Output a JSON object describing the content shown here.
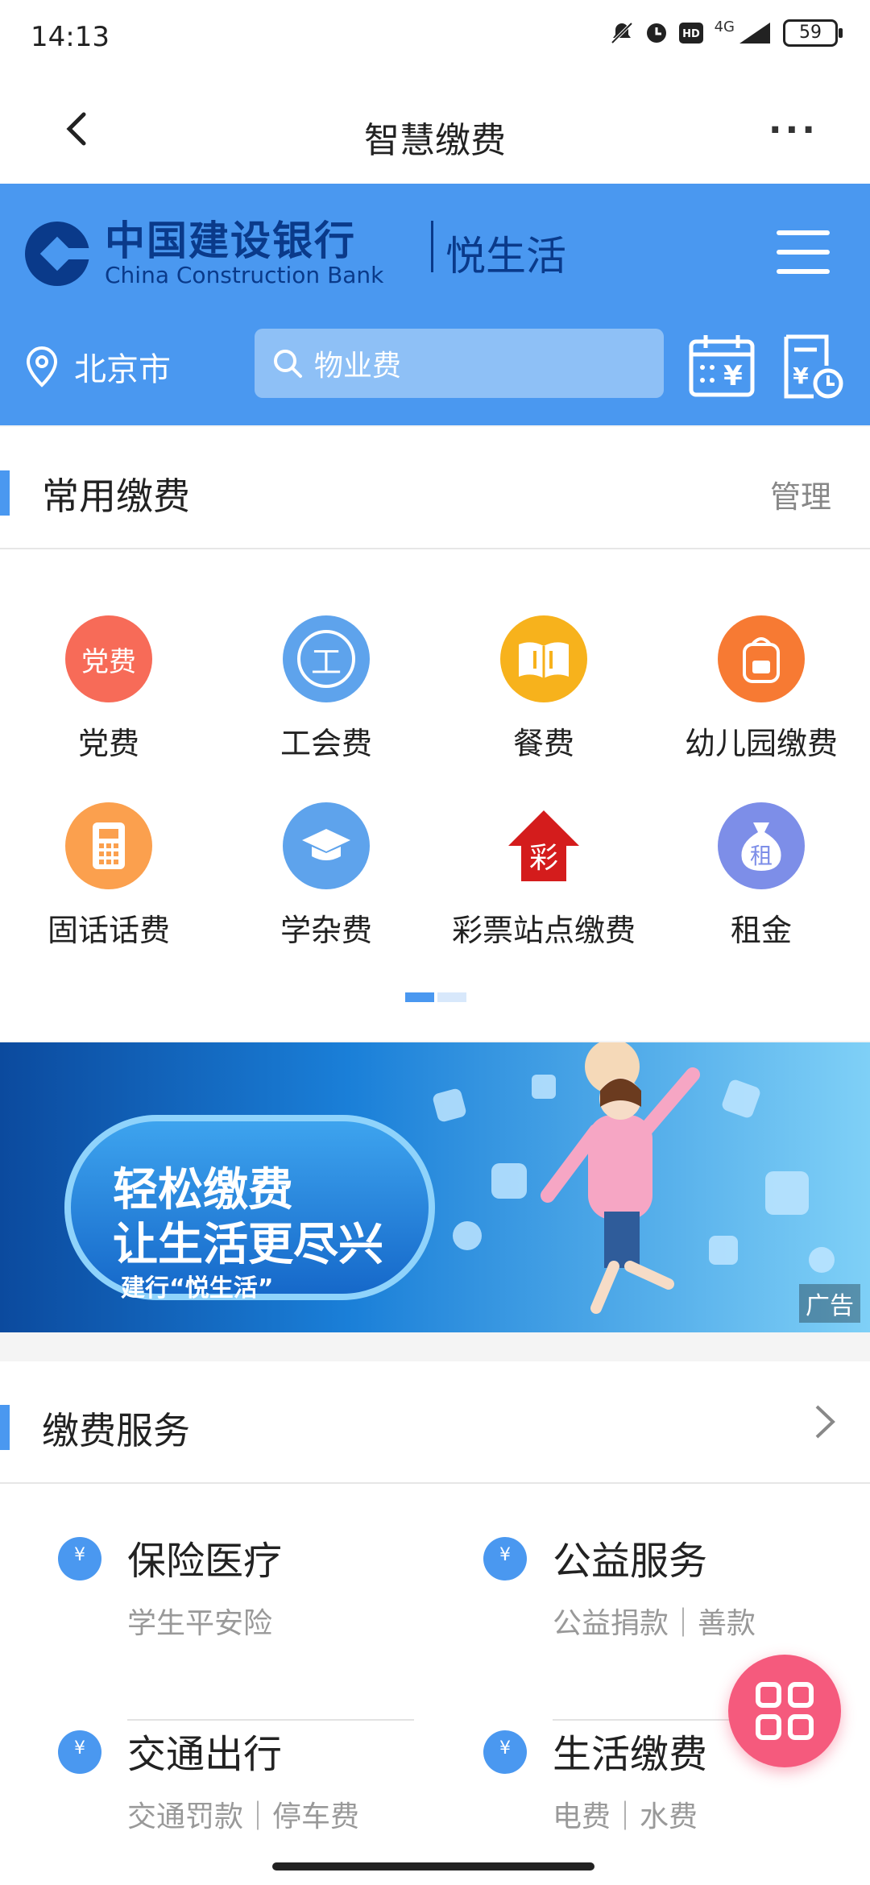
{
  "status": {
    "time": "14:13",
    "network": "4G",
    "battery": "59"
  },
  "nav": {
    "title": "智慧缴费",
    "more": "···"
  },
  "bank": {
    "name_cn": "中国建设银行",
    "name_en": "China Construction Bank",
    "brand": "悦生活",
    "city": "北京市",
    "search_placeholder": "物业费"
  },
  "common": {
    "title": "常用缴费",
    "manage": "管理",
    "items": [
      {
        "label": "党费",
        "icon": "party-fee-icon",
        "icon_text": "党费",
        "color": "#f76b58"
      },
      {
        "label": "工会费",
        "icon": "union-fee-icon",
        "icon_text": "工",
        "color": "#5ea3ec"
      },
      {
        "label": "餐费",
        "icon": "meal-fee-icon",
        "icon_text": "",
        "color": "#f7b21c"
      },
      {
        "label": "幼儿园缴费",
        "icon": "kindergarten-icon",
        "icon_text": "",
        "color": "#f77a33"
      },
      {
        "label": "固话话费",
        "icon": "landline-icon",
        "icon_text": "",
        "color": "#fba04e"
      },
      {
        "label": "学杂费",
        "icon": "tuition-icon",
        "icon_text": "",
        "color": "#5ea3ec"
      },
      {
        "label": "彩票站点缴费",
        "icon": "lottery-icon",
        "icon_text": "彩",
        "color": "#d41c1c"
      },
      {
        "label": "租金",
        "icon": "rent-icon",
        "icon_text": "租",
        "color": "#7d8ee8"
      }
    ]
  },
  "banner": {
    "line1": "轻松缴费",
    "line2": "让生活更尽兴",
    "line3": "建行“悦生活”",
    "ad": "广告"
  },
  "services": {
    "title": "缴费服务",
    "items": [
      {
        "title": "保险医疗",
        "subtitle": "学生平安险"
      },
      {
        "title": "公益服务",
        "subtitle": "公益捐款｜善款"
      },
      {
        "title": "交通出行",
        "subtitle": "交通罚款｜停车费"
      },
      {
        "title": "生活缴费",
        "subtitle": "电费｜水费"
      }
    ]
  },
  "colors": {
    "primary": "#4a98f0",
    "fab": "#f55a7d",
    "bank_dark": "#0a3a8a"
  }
}
